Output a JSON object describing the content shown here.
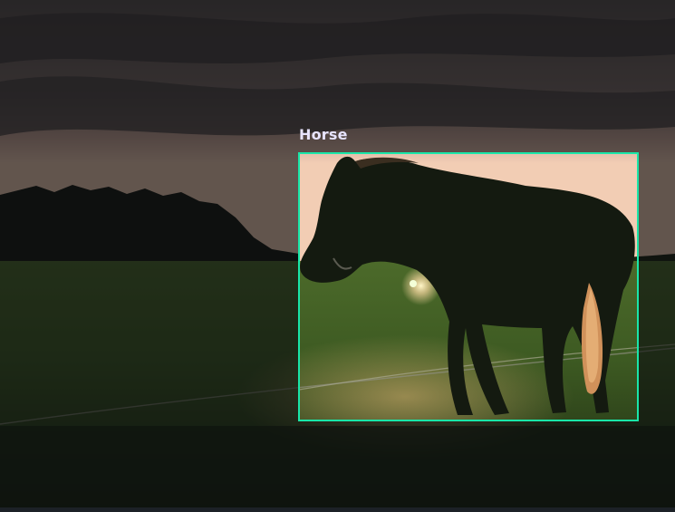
{
  "detections": [
    {
      "label": "Horse",
      "color": "#19e6a8"
    }
  ],
  "colors": {
    "box_stroke": "#19e6a8",
    "label_text": "#e8e4ff",
    "dim_overlay": "rgba(10,12,14,0.62)"
  },
  "scene": {
    "icon": "photo-image"
  }
}
